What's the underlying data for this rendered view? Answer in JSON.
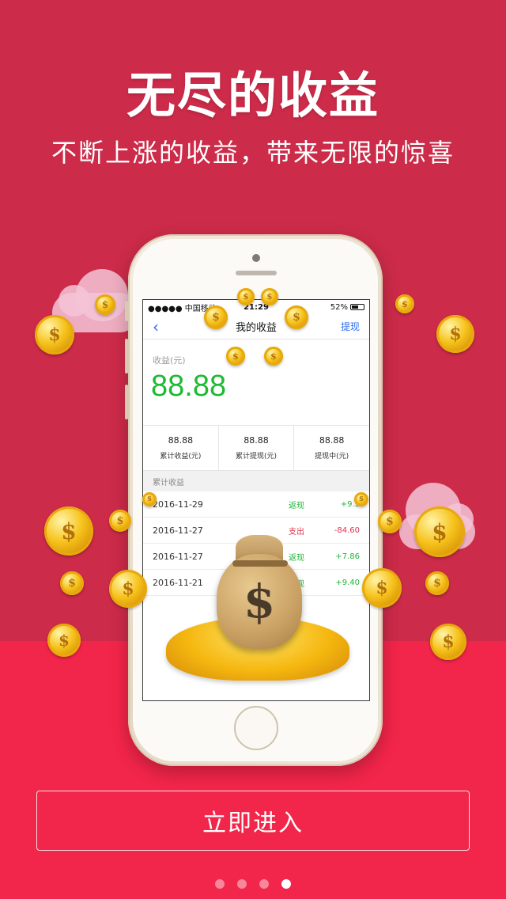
{
  "hero": {
    "title": "无尽的收益",
    "subtitle": "不断上涨的收益，带来无限的惊喜"
  },
  "phone": {
    "statusbar": {
      "carrier": "●●●●● 中国移动",
      "time": "21:29",
      "battery": "52%"
    },
    "navbar": {
      "back": "‹",
      "title": "我的收益",
      "action": "提现"
    },
    "earnings": {
      "label": "收益(元)",
      "amount": "88.88"
    },
    "stats": [
      {
        "value": "88.88",
        "label": "累计收益(元)"
      },
      {
        "value": "88.88",
        "label": "累计提现(元)"
      },
      {
        "value": "88.88",
        "label": "提现中(元)"
      }
    ],
    "section_title": "累计收益",
    "records": [
      {
        "date": "2016-11-29",
        "type": "返现",
        "amount": "+9.5"
      },
      {
        "date": "2016-11-27",
        "type": "支出",
        "amount": "-84.60"
      },
      {
        "date": "2016-11-27",
        "type": "返现",
        "amount": "+7.86"
      },
      {
        "date": "2016-11-21",
        "type": "返现",
        "amount": "+9.40"
      }
    ]
  },
  "coin_symbol": "$",
  "enter_button": "立即进入",
  "pager": {
    "count": 4,
    "active": 4
  },
  "colors": {
    "background_top": "#cc2b49",
    "background_bottom": "#f2254a",
    "positive": "#21b33a",
    "negative": "#e2324b",
    "link": "#2f6ff0"
  }
}
